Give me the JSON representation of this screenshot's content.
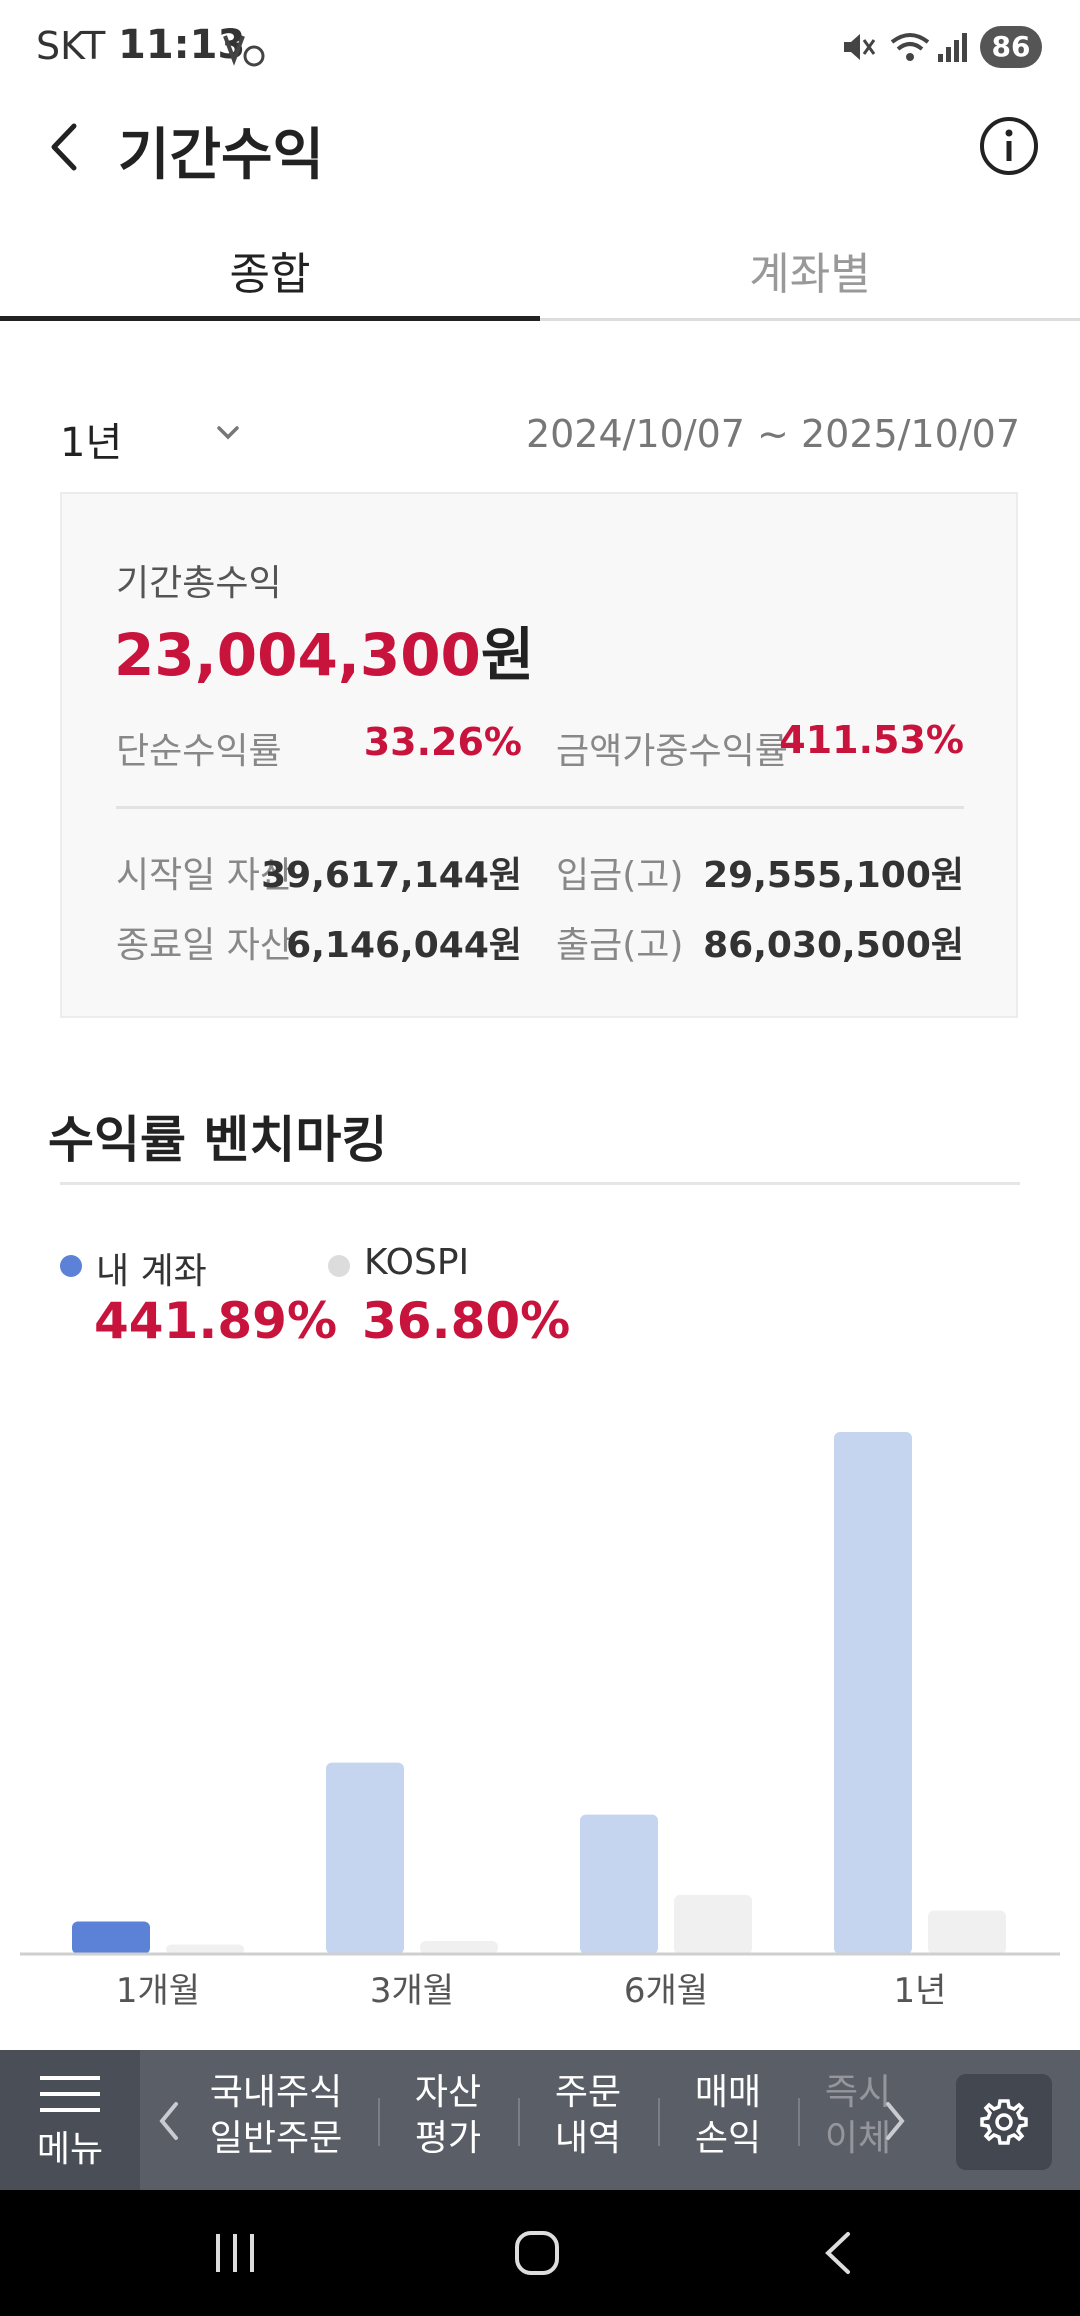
{
  "status_bar": {
    "carrier": "SKT",
    "time": "11:13",
    "battery": "86"
  },
  "header": {
    "title": "기간수익"
  },
  "tabs": [
    {
      "label": "종합",
      "active": true
    },
    {
      "label": "계좌별",
      "active": false
    }
  ],
  "period": {
    "selected": "1년",
    "date_range": "2024/10/07 ~ 2025/10/07"
  },
  "summary": {
    "total_label": "기간총수익",
    "total_value": "23,004,300",
    "total_unit": "원",
    "simple_return_label": "단순수익률",
    "simple_return_value": "33.26%",
    "weighted_return_label": "금액가중수익률",
    "weighted_return_value": "411.53%",
    "start_asset_label": "시작일 자산",
    "start_asset_value": "39,617,144원",
    "deposit_label": "입금(고)",
    "deposit_value": "29,555,100원",
    "end_asset_label": "종료일 자산",
    "end_asset_value": "6,146,044원",
    "withdraw_label": "출금(고)",
    "withdraw_value": "86,030,500원"
  },
  "benchmark": {
    "title": "수익률 벤치마킹",
    "legend": [
      {
        "label": "내 계좌",
        "value": "441.89%",
        "color": "#5b82d6"
      },
      {
        "label": "KOSPI",
        "value": "36.80%",
        "color": "#dcdcdc"
      }
    ]
  },
  "chart_data": {
    "type": "bar",
    "categories": [
      "1개월",
      "3개월",
      "6개월",
      "1년"
    ],
    "series": [
      {
        "name": "내 계좌",
        "values": [
          27.5,
          162,
          118,
          441.89
        ]
      },
      {
        "name": "KOSPI",
        "values": [
          8,
          11,
          50,
          36.8
        ]
      }
    ],
    "ylim": [
      0,
      441.89
    ],
    "colors": {
      "my_highlight": "#5b82d6",
      "my": "#c5d5ef",
      "kospi": "#f0f0f0"
    },
    "highlight_index": 0
  },
  "bottom_menu": {
    "menu_label": "메뉴",
    "items": [
      {
        "line1": "국내주식",
        "line2": "일반주문"
      },
      {
        "line1": "자산",
        "line2": "평가"
      },
      {
        "line1": "주문",
        "line2": "내역"
      },
      {
        "line1": "매매",
        "line2": "손익"
      },
      {
        "line1": "즉시",
        "line2": "이체"
      }
    ]
  }
}
